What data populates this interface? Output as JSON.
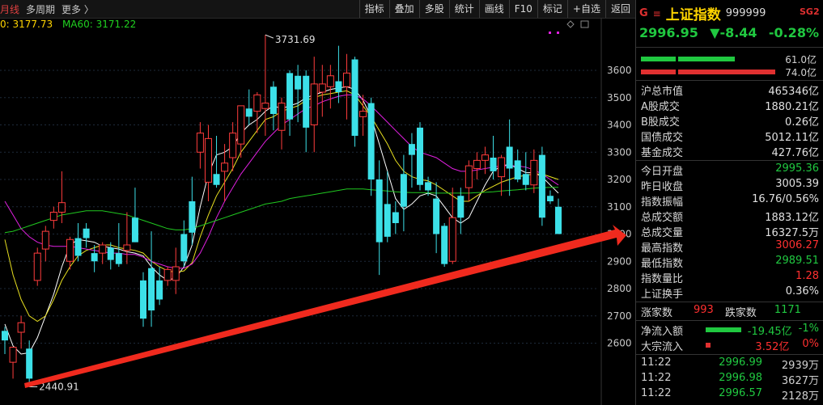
{
  "toolbar": {
    "period": "月线",
    "multi_period": "多周期",
    "more": "更多 〉",
    "buttons": [
      "指标",
      "叠加",
      "多股",
      "统计",
      "画线",
      "F10",
      "标记",
      "+自选",
      "返回"
    ]
  },
  "ma_legend": {
    "ma_a": "0: 3177.73",
    "ma60": "MA60: 3171.22"
  },
  "chart_data": {
    "type": "candlestick",
    "y_ticks": [
      2600,
      2700,
      2800,
      2900,
      3000,
      3100,
      3200,
      3300,
      3400,
      3500,
      3600
    ],
    "high_label": "3731.69",
    "low_label": "2440.91",
    "annotation": "red trend arrow from 2440.91 low toward latest bar",
    "candles": [
      {
        "o": 2645,
        "h": 2660,
        "l": 2560,
        "c": 2610
      },
      {
        "o": 2530,
        "h": 2580,
        "l": 2470,
        "c": 2585
      },
      {
        "o": 2640,
        "h": 2700,
        "l": 2580,
        "c": 2675
      },
      {
        "o": 2580,
        "h": 2610,
        "l": 2440,
        "c": 2470
      },
      {
        "o": 2830,
        "h": 2950,
        "l": 2810,
        "c": 2930
      },
      {
        "o": 2945,
        "h": 3030,
        "l": 2900,
        "c": 3010
      },
      {
        "o": 3050,
        "h": 3100,
        "l": 3020,
        "c": 3080
      },
      {
        "o": 3080,
        "h": 3230,
        "l": 3040,
        "c": 3115
      },
      {
        "o": 2900,
        "h": 2990,
        "l": 2870,
        "c": 2980
      },
      {
        "o": 2985,
        "h": 3040,
        "l": 2900,
        "c": 2920
      },
      {
        "o": 3020,
        "h": 3040,
        "l": 2950,
        "c": 2985
      },
      {
        "o": 2930,
        "h": 2960,
        "l": 2860,
        "c": 2900
      },
      {
        "o": 2930,
        "h": 2970,
        "l": 2890,
        "c": 2960
      },
      {
        "o": 2950,
        "h": 2970,
        "l": 2870,
        "c": 2905
      },
      {
        "o": 2930,
        "h": 3040,
        "l": 2880,
        "c": 2890
      },
      {
        "o": 2940,
        "h": 3080,
        "l": 2890,
        "c": 2960
      },
      {
        "o": 3060,
        "h": 3170,
        "l": 2970,
        "c": 2970
      },
      {
        "o": 2830,
        "h": 2860,
        "l": 2660,
        "c": 2690
      },
      {
        "o": 2875,
        "h": 3010,
        "l": 2660,
        "c": 2720
      },
      {
        "o": 2830,
        "h": 2880,
        "l": 2740,
        "c": 2760
      },
      {
        "o": 2830,
        "h": 2880,
        "l": 2810,
        "c": 2870
      },
      {
        "o": 2830,
        "h": 2950,
        "l": 2780,
        "c": 2880
      },
      {
        "o": 3000,
        "h": 3050,
        "l": 2880,
        "c": 2900
      },
      {
        "o": 3120,
        "h": 3210,
        "l": 2960,
        "c": 3005
      },
      {
        "o": 3300,
        "h": 3410,
        "l": 3240,
        "c": 3370
      },
      {
        "o": 3190,
        "h": 3400,
        "l": 3120,
        "c": 3350
      },
      {
        "o": 3220,
        "h": 3360,
        "l": 3170,
        "c": 3180
      },
      {
        "o": 3230,
        "h": 3330,
        "l": 3120,
        "c": 3260
      },
      {
        "o": 3280,
        "h": 3410,
        "l": 3230,
        "c": 3370
      },
      {
        "o": 3330,
        "h": 3470,
        "l": 3280,
        "c": 3470
      },
      {
        "o": 3460,
        "h": 3530,
        "l": 3400,
        "c": 3430
      },
      {
        "o": 3450,
        "h": 3520,
        "l": 3370,
        "c": 3510
      },
      {
        "o": 3460,
        "h": 3730,
        "l": 3360,
        "c": 3480
      },
      {
        "o": 3540,
        "h": 3560,
        "l": 3380,
        "c": 3440
      },
      {
        "o": 3380,
        "h": 3500,
        "l": 3310,
        "c": 3480
      },
      {
        "o": 3590,
        "h": 3600,
        "l": 3360,
        "c": 3420
      },
      {
        "o": 3580,
        "h": 3620,
        "l": 3410,
        "c": 3530
      },
      {
        "o": 3580,
        "h": 3600,
        "l": 3300,
        "c": 3390
      },
      {
        "o": 3400,
        "h": 3650,
        "l": 3300,
        "c": 3550
      },
      {
        "o": 3520,
        "h": 3620,
        "l": 3430,
        "c": 3550
      },
      {
        "o": 3540,
        "h": 3620,
        "l": 3460,
        "c": 3580
      },
      {
        "o": 3560,
        "h": 3690,
        "l": 3480,
        "c": 3520
      },
      {
        "o": 3540,
        "h": 3660,
        "l": 3420,
        "c": 3590
      },
      {
        "o": 3640,
        "h": 3650,
        "l": 3320,
        "c": 3360
      },
      {
        "o": 3430,
        "h": 3510,
        "l": 3360,
        "c": 3450
      },
      {
        "o": 3480,
        "h": 3500,
        "l": 3140,
        "c": 3200
      },
      {
        "o": 3200,
        "h": 3270,
        "l": 2850,
        "c": 2970
      },
      {
        "o": 3110,
        "h": 3230,
        "l": 2970,
        "c": 2990
      },
      {
        "o": 3080,
        "h": 3120,
        "l": 3000,
        "c": 3040
      },
      {
        "o": 3220,
        "h": 3290,
        "l": 3010,
        "c": 3100
      },
      {
        "o": 3330,
        "h": 3370,
        "l": 3170,
        "c": 3290
      },
      {
        "o": 3390,
        "h": 3410,
        "l": 3160,
        "c": 3180
      },
      {
        "o": 3190,
        "h": 3210,
        "l": 3140,
        "c": 3160
      },
      {
        "o": 3130,
        "h": 3190,
        "l": 2930,
        "c": 3000
      },
      {
        "o": 3030,
        "h": 3040,
        "l": 2880,
        "c": 2890
      },
      {
        "o": 2900,
        "h": 3170,
        "l": 2890,
        "c": 3060
      },
      {
        "o": 3140,
        "h": 3170,
        "l": 3000,
        "c": 3060
      },
      {
        "o": 3170,
        "h": 3270,
        "l": 3120,
        "c": 3250
      },
      {
        "o": 3240,
        "h": 3300,
        "l": 3200,
        "c": 3270
      },
      {
        "o": 3270,
        "h": 3320,
        "l": 3220,
        "c": 3290
      },
      {
        "o": 3280,
        "h": 3360,
        "l": 3200,
        "c": 3230
      },
      {
        "o": 3210,
        "h": 3290,
        "l": 3140,
        "c": 3280
      },
      {
        "o": 3320,
        "h": 3420,
        "l": 3140,
        "c": 3240
      },
      {
        "o": 3270,
        "h": 3310,
        "l": 3190,
        "c": 3200
      },
      {
        "o": 3220,
        "h": 3300,
        "l": 3160,
        "c": 3180
      },
      {
        "o": 3180,
        "h": 3310,
        "l": 3150,
        "c": 3270
      },
      {
        "o": 3290,
        "h": 3320,
        "l": 3030,
        "c": 3060
      },
      {
        "o": 3140,
        "h": 3160,
        "l": 3110,
        "c": 3120
      },
      {
        "o": 3100,
        "h": 3130,
        "l": 3000,
        "c": 3000
      }
    ],
    "ma_lines": [
      {
        "color": "#ffffff",
        "values": [
          2670,
          2590,
          2560,
          2565,
          2620,
          2700,
          2780,
          2880,
          2960,
          2980,
          2975,
          2970,
          2955,
          2950,
          2945,
          2935,
          2930,
          2920,
          2880,
          2850,
          2830,
          2840,
          2880,
          2960,
          3100,
          3220,
          3290,
          3300,
          3320,
          3370,
          3400,
          3420,
          3450,
          3470,
          3460,
          3470,
          3480,
          3500,
          3510,
          3520,
          3530,
          3535,
          3540,
          3530,
          3490,
          3430,
          3330,
          3230,
          3130,
          3090,
          3110,
          3140,
          3150,
          3140,
          3100,
          3060,
          3040,
          3060,
          3120,
          3180,
          3230,
          3250,
          3255,
          3240,
          3225,
          3225,
          3210,
          3180,
          3150
        ]
      },
      {
        "color": "#e8e020",
        "values": [
          2980,
          2850,
          2760,
          2700,
          2680,
          2700,
          2760,
          2830,
          2880,
          2920,
          2940,
          2950,
          2960,
          2960,
          2950,
          2945,
          2940,
          2930,
          2900,
          2880,
          2865,
          2860,
          2865,
          2895,
          2990,
          3070,
          3140,
          3190,
          3240,
          3300,
          3340,
          3380,
          3420,
          3430,
          3450,
          3460,
          3470,
          3490,
          3500,
          3510,
          3515,
          3520,
          3525,
          3510,
          3470,
          3430,
          3380,
          3330,
          3270,
          3230,
          3210,
          3200,
          3195,
          3180,
          3160,
          3140,
          3120,
          3120,
          3140,
          3160,
          3175,
          3190,
          3200,
          3210,
          3215,
          3220,
          3220,
          3210,
          3200
        ]
      },
      {
        "color": "#e020e0",
        "values": [
          3120,
          3070,
          3020,
          2990,
          2970,
          2960,
          2955,
          2955,
          2955,
          2950,
          2945,
          2940,
          2935,
          2930,
          2930,
          2925,
          2925,
          2915,
          2900,
          2890,
          2880,
          2875,
          2875,
          2890,
          2930,
          2990,
          3060,
          3120,
          3170,
          3220,
          3260,
          3300,
          3340,
          3370,
          3400,
          3420,
          3440,
          3460,
          3470,
          3485,
          3495,
          3505,
          3510,
          3510,
          3495,
          3470,
          3440,
          3410,
          3380,
          3350,
          3320,
          3300,
          3290,
          3280,
          3260,
          3240,
          3230,
          3230,
          3235,
          3240,
          3245,
          3250,
          3250,
          3250,
          3245,
          3235,
          3220,
          3200,
          3180
        ]
      },
      {
        "color": "#20c820",
        "values": [
          3005,
          3010,
          3020,
          3030,
          3040,
          3050,
          3060,
          3070,
          3075,
          3080,
          3085,
          3085,
          3085,
          3080,
          3075,
          3070,
          3060,
          3050,
          3040,
          3030,
          3020,
          3015,
          3015,
          3020,
          3030,
          3040,
          3050,
          3060,
          3070,
          3080,
          3090,
          3100,
          3110,
          3115,
          3120,
          3130,
          3135,
          3140,
          3145,
          3150,
          3155,
          3160,
          3165,
          3165,
          3165,
          3162,
          3160,
          3158,
          3155,
          3153,
          3152,
          3152,
          3151,
          3150,
          3150,
          3150,
          3150,
          3150,
          3152,
          3153,
          3155,
          3158,
          3160,
          3162,
          3165,
          3168,
          3170,
          3171,
          3171
        ]
      }
    ]
  },
  "panel": {
    "g_icon": "G",
    "menu_icon": "≡",
    "name": "上证指数",
    "code": "999999",
    "sg": "SG2",
    "price": "2996.95",
    "change": "▼-8.44",
    "change_pct": "-0.28%",
    "buy_volume": "61.0亿",
    "sell_volume": "74.0亿",
    "rows": [
      {
        "k": "沪总市值",
        "v": "465346亿",
        "c": ""
      },
      {
        "k": "A股成交",
        "v": "1880.21亿",
        "c": ""
      },
      {
        "k": "B股成交",
        "v": "0.26亿",
        "c": ""
      },
      {
        "k": "国债成交",
        "v": "5012.11亿",
        "c": ""
      },
      {
        "k": "基金成交",
        "v": "427.76亿",
        "c": ""
      },
      {
        "k": "今日开盘",
        "v": "2995.36",
        "c": "green"
      },
      {
        "k": "昨日收盘",
        "v": "3005.39",
        "c": ""
      },
      {
        "k": "指数振幅",
        "v": "16.76/0.56%",
        "c": ""
      },
      {
        "k": "总成交额",
        "v": "1883.12亿",
        "c": ""
      },
      {
        "k": "总成交量",
        "v": "16327.5万",
        "c": ""
      },
      {
        "k": "最高指数",
        "v": "3006.27",
        "c": "red"
      },
      {
        "k": "最低指数",
        "v": "2989.51",
        "c": "green"
      },
      {
        "k": "指数量比",
        "v": "1.28",
        "c": "red"
      },
      {
        "k": "上证换手",
        "v": "0.36%",
        "c": ""
      }
    ],
    "up_label": "涨家数",
    "up_count": "993",
    "down_label": "跌家数",
    "down_count": "1171",
    "net_inflow_label": "净流入额",
    "net_inflow": "-19.45亿",
    "net_inflow_pct": "-1%",
    "block_inflow_label": "大宗流入",
    "block_inflow": "3.52亿",
    "block_inflow_pct": "0%",
    "ticks": [
      {
        "t": "11:22",
        "p": "2996.99",
        "v": "2939万"
      },
      {
        "t": "11:22",
        "p": "2996.98",
        "v": "3627万"
      },
      {
        "t": "11:22",
        "p": "2996.57",
        "v": "2128万"
      }
    ]
  }
}
